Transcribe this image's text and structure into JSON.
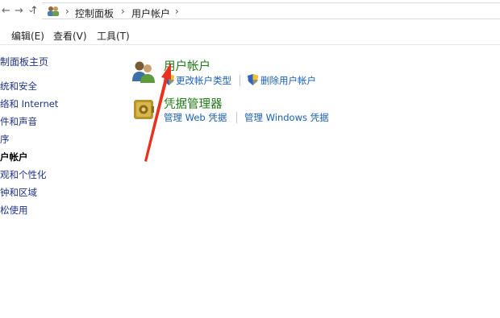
{
  "nav": {
    "back": "←",
    "forward": "→",
    "dropdown": "⌄",
    "up": "↑"
  },
  "breadcrumb": {
    "sep1": "›",
    "item1": "控制面板",
    "sep2": "›",
    "item2": "用户帐户",
    "sep3": "›"
  },
  "menubar": {
    "edit": "编辑(E)",
    "view": "查看(V)",
    "tools": "工具(T)"
  },
  "sidebar": {
    "home": "制面板主页",
    "items": [
      "统和安全",
      "络和 Internet",
      "件和声音",
      "序",
      "户帐户",
      "观和个性化",
      "钟和区域",
      "松使用"
    ]
  },
  "user_accounts": {
    "title": "用户帐户",
    "change_type": "更改帐户类型",
    "remove": "删除用户帐户"
  },
  "credentials": {
    "title": "凭据管理器",
    "web": "管理 Web 凭据",
    "windows": "管理 Windows 凭据"
  },
  "colors": {
    "heading": "#1e7a14",
    "link": "#1a5fb4",
    "sidebar_link": "#1e3287",
    "arrow": "#e8321e"
  }
}
